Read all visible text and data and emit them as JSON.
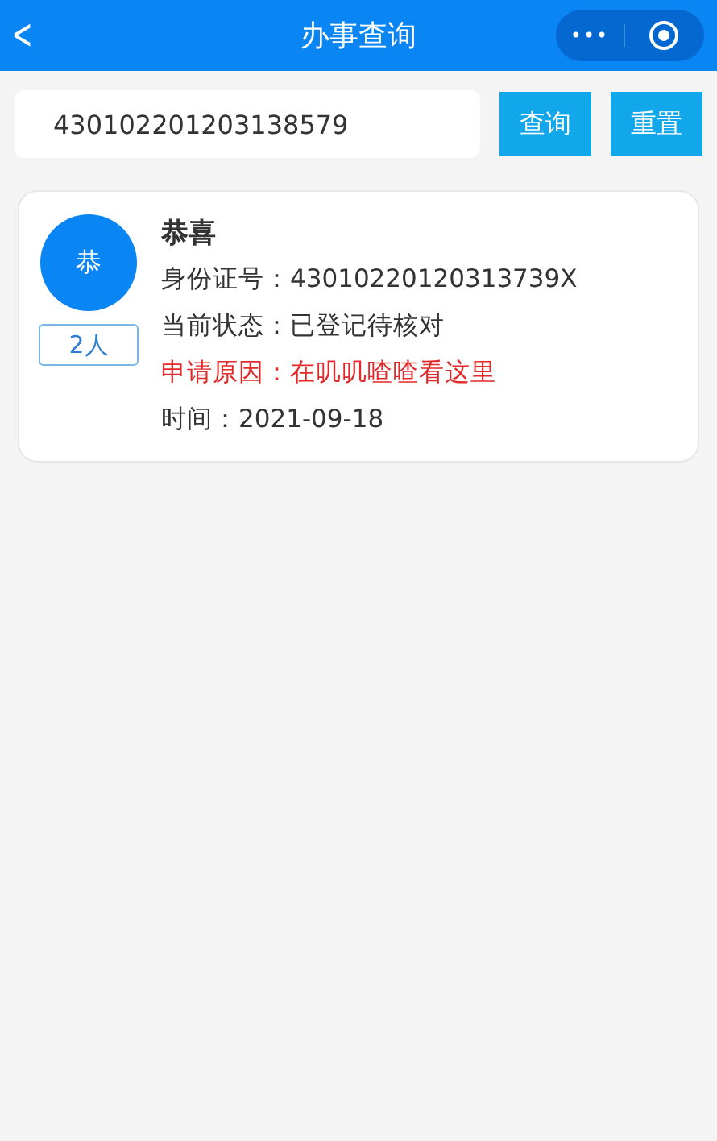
{
  "header": {
    "back": "<",
    "title": "办事查询",
    "menu": "•••"
  },
  "search": {
    "value": "430102201203138579",
    "buttons": [
      "查询",
      "重置"
    ]
  },
  "results": [
    {
      "avatar": "恭",
      "count": "2人",
      "name": "恭喜",
      "lines": [
        {
          "kind": "normal",
          "text": "身份证号：43010220120313739X"
        },
        {
          "kind": "normal",
          "text": "当前状态：已登记待核对"
        },
        {
          "kind": "alert",
          "text": "申请原因：在叽叽喳喳看这里"
        },
        {
          "kind": "normal",
          "text": "时间：2021-09-18"
        }
      ]
    }
  ]
}
